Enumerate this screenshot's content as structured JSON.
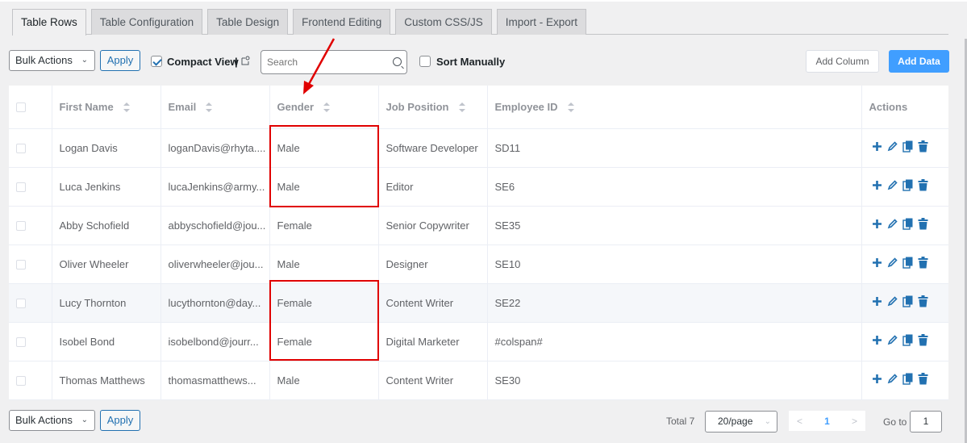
{
  "tabs": [
    {
      "label": "Table Rows",
      "active": true
    },
    {
      "label": "Table Configuration",
      "active": false
    },
    {
      "label": "Table Design",
      "active": false
    },
    {
      "label": "Frontend Editing",
      "active": false
    },
    {
      "label": "Custom CSS/JS",
      "active": false
    },
    {
      "label": "Import - Export",
      "active": false
    }
  ],
  "toolbar": {
    "bulk_actions": "Bulk Actions",
    "apply": "Apply",
    "compact_view": "Compact View",
    "compact_view_checked": true,
    "separator": "|",
    "search_placeholder": "Search",
    "sort_manually": "Sort Manually",
    "sort_manually_checked": false,
    "add_column": "Add Column",
    "add_data": "Add Data"
  },
  "table": {
    "columns": [
      "First Name",
      "Email",
      "Gender",
      "Job Position",
      "Employee ID",
      "Actions"
    ],
    "rows": [
      {
        "first_name": "Logan Davis",
        "email": "loganDavis@rhyta....",
        "gender": "Male",
        "job": "Software Developer",
        "id": "SD11"
      },
      {
        "first_name": "Luca Jenkins",
        "email": "lucaJenkins@army...",
        "gender": "Male",
        "job": "Editor",
        "id": "SE6"
      },
      {
        "first_name": "Abby Schofield",
        "email": "abbyschofield@jou...",
        "gender": "Female",
        "job": "Senior Copywriter",
        "id": "SE35"
      },
      {
        "first_name": "Oliver Wheeler",
        "email": "oliverwheeler@jou...",
        "gender": "Male",
        "job": "Designer",
        "id": "SE10"
      },
      {
        "first_name": "Lucy Thornton",
        "email": "lucythornton@day...",
        "gender": "Female",
        "job": "Content Writer",
        "id": "SE22"
      },
      {
        "first_name": "Isobel Bond",
        "email": "isobelbond@jourr...",
        "gender": "Female",
        "job": "Digital Marketer",
        "id": "#colspan#"
      },
      {
        "first_name": "Thomas Matthews",
        "email": "thomasmatthews...",
        "gender": "Male",
        "job": "Content Writer",
        "id": "SE30"
      }
    ],
    "row_actions": [
      "add-icon",
      "edit-pencil-icon",
      "copy-icon",
      "trash-icon"
    ]
  },
  "footer": {
    "bulk_actions": "Bulk Actions",
    "apply": "Apply",
    "total": "Total 7",
    "per_page": "20/page",
    "prev": "<",
    "current_page": "1",
    "next": ">",
    "goto_label": "Go to",
    "goto_value": "1"
  },
  "colors": {
    "accent_blue": "#409eff",
    "wp_blue": "#2271b1",
    "annotation_red": "#e00000"
  }
}
